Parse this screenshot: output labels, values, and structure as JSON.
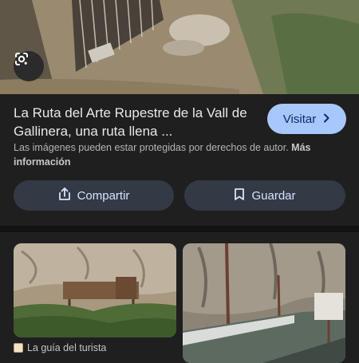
{
  "result": {
    "title": "La Ruta del Arte Rupestre de la Vall de Gallinera, una ruta llena ...",
    "visit_label": "Visitar",
    "copyright_text": "Las imágenes pueden estar protegidas por derechos de autor.",
    "more_info_label": "Más información",
    "share_label": "Compartir",
    "save_label": "Guardar"
  },
  "related": [
    {
      "source": "La guía del turista"
    }
  ],
  "icons": {
    "lens": "google-lens-icon",
    "chevron": "chevron-right-icon",
    "share": "share-icon",
    "bookmark": "bookmark-icon"
  },
  "colors": {
    "background": "#1f1f1f",
    "visit_button": "#a8c7fa",
    "action_button": "#333a45"
  }
}
